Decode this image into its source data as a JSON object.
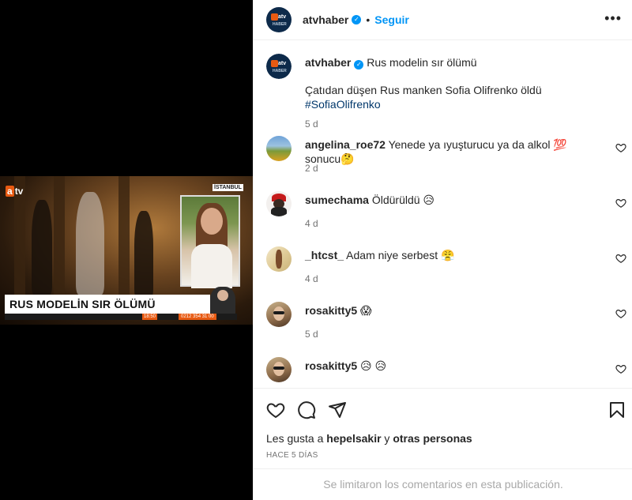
{
  "media": {
    "channel_logo": "tv",
    "channel_logo_mark": "a",
    "location_tag": "İSTANBUL",
    "headline": "RUS MODELİN SIR ÖLÜMÜ",
    "ticker_time": "18:50",
    "ticker_phone": "0212 354 31 00"
  },
  "header": {
    "username": "atvhaber",
    "separator": "•",
    "follow_label": "Seguir",
    "more_label": "•••",
    "avatar_text": "atv",
    "avatar_sub": "HABER"
  },
  "caption": {
    "username": "atvhaber",
    "title": "Rus modelin sır ölümü",
    "text": "Çatıdan düşen Rus manken Sofia Olifrenko öldü ",
    "hashtag": "#SofiaOlifrenko",
    "time": "5 d"
  },
  "comments": [
    {
      "username": "angelina_roe72",
      "text": "Yenede ya ıyuşturucu ya da alkol 💯  sonucu🤔",
      "time": "2 d"
    },
    {
      "username": "sumechama",
      "text": "Öldürüldü 😥",
      "time": "4 d"
    },
    {
      "username": "_htcst_",
      "text": "Adam niye serbest 😤",
      "time": "4 d"
    },
    {
      "username": "rosakitty5",
      "text": "😱",
      "time": "5 d"
    },
    {
      "username": "rosakitty5",
      "text": "😥 😥",
      "time": ""
    }
  ],
  "actions": {
    "likes_prefix": "Les gusta a ",
    "likes_user": "hepelsakir",
    "likes_middle": " y ",
    "likes_others": "otras personas",
    "date": "HACE 5 DÍAS",
    "comments_limited": "Se limitaron los comentarios en esta publicación."
  },
  "colors": {
    "accent": "#0095f6",
    "text": "#262626",
    "muted": "#737373",
    "hashtag": "#00376b",
    "border": "#efefef",
    "brand_orange": "#e85a12"
  }
}
